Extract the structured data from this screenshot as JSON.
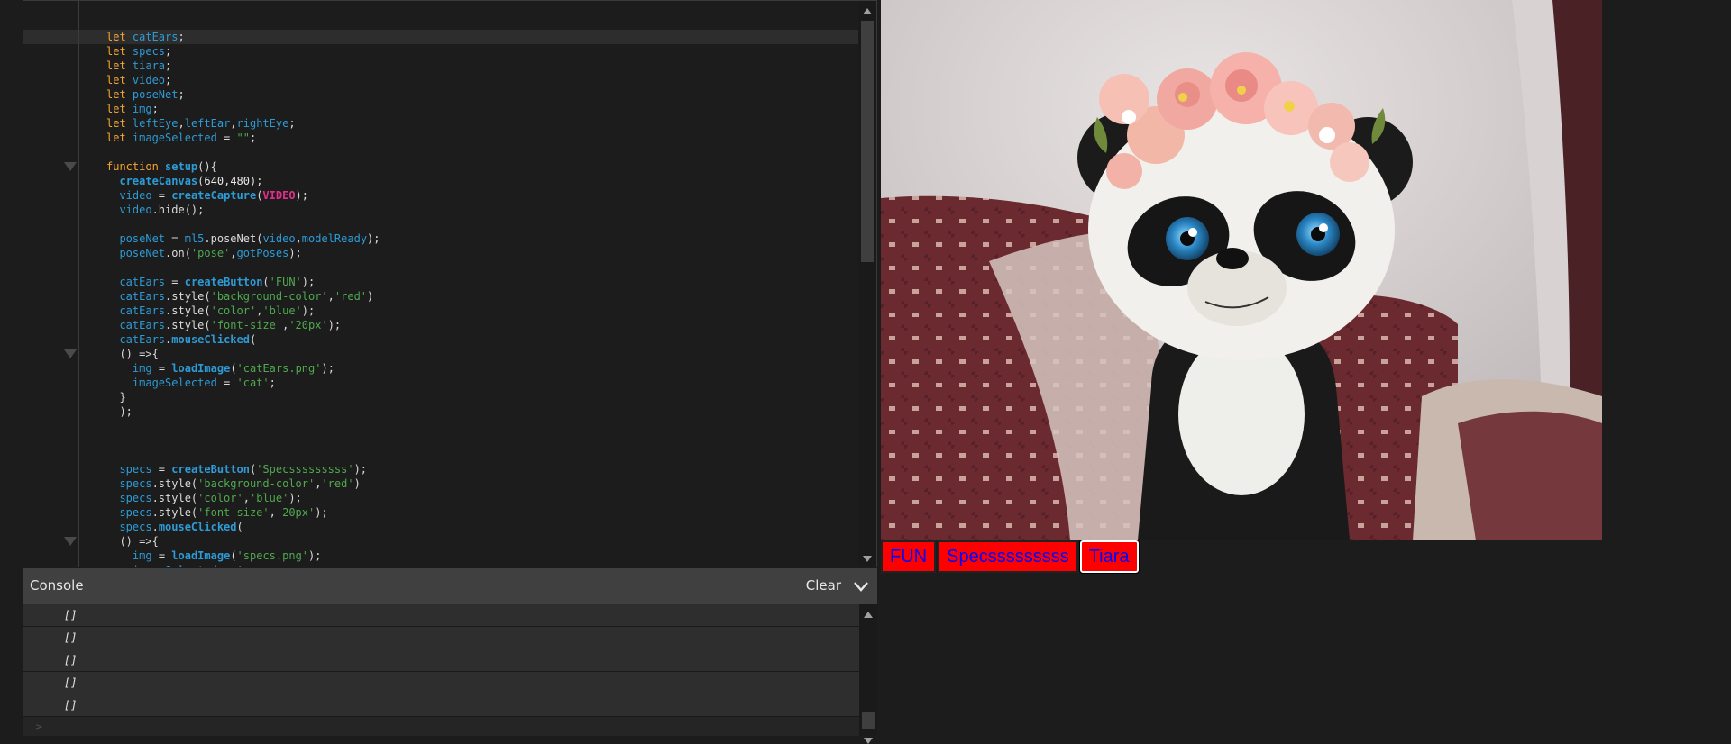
{
  "editor": {
    "lines": [
      {
        "active": true,
        "fold": false,
        "tokens": [
          [
            "kw",
            "let "
          ],
          [
            "var",
            "catEars"
          ],
          [
            "",
            "; "
          ]
        ]
      },
      {
        "fold": false,
        "tokens": [
          [
            "kw",
            "let "
          ],
          [
            "var",
            "specs"
          ],
          [
            "",
            ";"
          ]
        ]
      },
      {
        "fold": false,
        "tokens": [
          [
            "kw",
            "let "
          ],
          [
            "var",
            "tiara"
          ],
          [
            "",
            ";"
          ]
        ]
      },
      {
        "fold": false,
        "tokens": [
          [
            "kw",
            "let "
          ],
          [
            "var",
            "video"
          ],
          [
            "",
            ";"
          ]
        ]
      },
      {
        "fold": false,
        "tokens": [
          [
            "kw",
            "let "
          ],
          [
            "var",
            "poseNet"
          ],
          [
            "",
            ";"
          ]
        ]
      },
      {
        "fold": false,
        "tokens": [
          [
            "kw",
            "let "
          ],
          [
            "var",
            "img"
          ],
          [
            "",
            ";"
          ]
        ]
      },
      {
        "fold": false,
        "tokens": [
          [
            "kw",
            "let "
          ],
          [
            "var",
            "leftEye"
          ],
          [
            "",
            ","
          ],
          [
            "var",
            "leftEar"
          ],
          [
            "",
            ","
          ],
          [
            "var",
            "rightEye"
          ],
          [
            "",
            ";"
          ]
        ]
      },
      {
        "fold": false,
        "tokens": [
          [
            "kw",
            "let "
          ],
          [
            "var",
            "imageSelected"
          ],
          [
            "",
            " = "
          ],
          [
            "str",
            "\"\""
          ],
          [
            "",
            ";"
          ]
        ]
      },
      {
        "fold": false,
        "tokens": []
      },
      {
        "fold": true,
        "tokens": [
          [
            "kw",
            "function "
          ],
          [
            "call",
            "setup"
          ],
          [
            "",
            "(){"
          ]
        ]
      },
      {
        "fold": false,
        "tokens": [
          [
            "",
            "  "
          ],
          [
            "call",
            "createCanvas"
          ],
          [
            "",
            "("
          ],
          [
            "num",
            "640"
          ],
          [
            "",
            ","
          ],
          [
            "num",
            "480"
          ],
          [
            "",
            ");"
          ]
        ]
      },
      {
        "fold": false,
        "tokens": [
          [
            "",
            "  "
          ],
          [
            "var",
            "video"
          ],
          [
            "",
            " = "
          ],
          [
            "call",
            "createCapture"
          ],
          [
            "",
            "("
          ],
          [
            "const",
            "VIDEO"
          ],
          [
            "",
            ");"
          ]
        ]
      },
      {
        "fold": false,
        "tokens": [
          [
            "",
            "  "
          ],
          [
            "var",
            "video"
          ],
          [
            "",
            ".hide();"
          ]
        ]
      },
      {
        "fold": false,
        "tokens": []
      },
      {
        "fold": false,
        "tokens": [
          [
            "",
            "  "
          ],
          [
            "var",
            "poseNet"
          ],
          [
            "",
            " = "
          ],
          [
            "var",
            "ml5"
          ],
          [
            "",
            ".poseNet("
          ],
          [
            "var",
            "video"
          ],
          [
            "",
            ","
          ],
          [
            "var",
            "modelReady"
          ],
          [
            "",
            ");"
          ]
        ]
      },
      {
        "fold": false,
        "tokens": [
          [
            "",
            "  "
          ],
          [
            "var",
            "poseNet"
          ],
          [
            "",
            ".on("
          ],
          [
            "str",
            "'pose'"
          ],
          [
            "",
            ","
          ],
          [
            "var",
            "gotPoses"
          ],
          [
            "",
            ");"
          ]
        ]
      },
      {
        "fold": false,
        "tokens": []
      },
      {
        "fold": false,
        "tokens": [
          [
            "",
            "  "
          ],
          [
            "var",
            "catEars"
          ],
          [
            "",
            " = "
          ],
          [
            "call",
            "createButton"
          ],
          [
            "",
            "("
          ],
          [
            "str",
            "'FUN'"
          ],
          [
            "",
            ");"
          ]
        ]
      },
      {
        "fold": false,
        "tokens": [
          [
            "",
            "  "
          ],
          [
            "var",
            "catEars"
          ],
          [
            "",
            ".style("
          ],
          [
            "str",
            "'background-color'"
          ],
          [
            "",
            ","
          ],
          [
            "str",
            "'red'"
          ],
          [
            "",
            ")"
          ]
        ]
      },
      {
        "fold": false,
        "tokens": [
          [
            "",
            "  "
          ],
          [
            "var",
            "catEars"
          ],
          [
            "",
            ".style("
          ],
          [
            "str",
            "'color'"
          ],
          [
            "",
            ","
          ],
          [
            "str",
            "'blue'"
          ],
          [
            "",
            ");"
          ]
        ]
      },
      {
        "fold": false,
        "tokens": [
          [
            "",
            "  "
          ],
          [
            "var",
            "catEars"
          ],
          [
            "",
            ".style("
          ],
          [
            "str",
            "'font-size'"
          ],
          [
            "",
            ","
          ],
          [
            "str",
            "'20px'"
          ],
          [
            "",
            ");"
          ]
        ]
      },
      {
        "fold": false,
        "tokens": [
          [
            "",
            "  "
          ],
          [
            "var",
            "catEars"
          ],
          [
            "",
            "."
          ],
          [
            "call",
            "mouseClicked"
          ],
          [
            "",
            "("
          ]
        ]
      },
      {
        "fold": true,
        "tokens": [
          [
            "",
            "  () =>{"
          ]
        ]
      },
      {
        "fold": false,
        "tokens": [
          [
            "",
            "    "
          ],
          [
            "var",
            "img"
          ],
          [
            "",
            " = "
          ],
          [
            "call",
            "loadImage"
          ],
          [
            "",
            "("
          ],
          [
            "str",
            "'catEars.png'"
          ],
          [
            "",
            ");"
          ]
        ]
      },
      {
        "fold": false,
        "tokens": [
          [
            "",
            "    "
          ],
          [
            "var",
            "imageSelected"
          ],
          [
            "",
            " = "
          ],
          [
            "str",
            "'cat'"
          ],
          [
            "",
            ";"
          ]
        ]
      },
      {
        "fold": false,
        "tokens": [
          [
            "",
            "  }"
          ]
        ]
      },
      {
        "fold": false,
        "tokens": [
          [
            "",
            "  );"
          ]
        ]
      },
      {
        "fold": false,
        "tokens": []
      },
      {
        "fold": false,
        "tokens": []
      },
      {
        "fold": false,
        "tokens": []
      },
      {
        "fold": false,
        "tokens": [
          [
            "",
            "  "
          ],
          [
            "var",
            "specs"
          ],
          [
            "",
            " = "
          ],
          [
            "call",
            "createButton"
          ],
          [
            "",
            "("
          ],
          [
            "str",
            "'Specsssssssss'"
          ],
          [
            "",
            ");"
          ]
        ]
      },
      {
        "fold": false,
        "tokens": [
          [
            "",
            "  "
          ],
          [
            "var",
            "specs"
          ],
          [
            "",
            ".style("
          ],
          [
            "str",
            "'background-color'"
          ],
          [
            "",
            ","
          ],
          [
            "str",
            "'red'"
          ],
          [
            "",
            ")"
          ]
        ]
      },
      {
        "fold": false,
        "tokens": [
          [
            "",
            "  "
          ],
          [
            "var",
            "specs"
          ],
          [
            "",
            ".style("
          ],
          [
            "str",
            "'color'"
          ],
          [
            "",
            ","
          ],
          [
            "str",
            "'blue'"
          ],
          [
            "",
            ");"
          ]
        ]
      },
      {
        "fold": false,
        "tokens": [
          [
            "",
            "  "
          ],
          [
            "var",
            "specs"
          ],
          [
            "",
            ".style("
          ],
          [
            "str",
            "'font-size'"
          ],
          [
            "",
            ","
          ],
          [
            "str",
            "'20px'"
          ],
          [
            "",
            ");"
          ]
        ]
      },
      {
        "fold": false,
        "tokens": [
          [
            "",
            "  "
          ],
          [
            "var",
            "specs"
          ],
          [
            "",
            "."
          ],
          [
            "call",
            "mouseClicked"
          ],
          [
            "",
            "("
          ]
        ]
      },
      {
        "fold": true,
        "tokens": [
          [
            "",
            "  () =>{"
          ]
        ]
      },
      {
        "fold": false,
        "tokens": [
          [
            "",
            "    "
          ],
          [
            "var",
            "img"
          ],
          [
            "",
            " = "
          ],
          [
            "call",
            "loadImage"
          ],
          [
            "",
            "("
          ],
          [
            "str",
            "'specs.png'"
          ],
          [
            "",
            ");"
          ]
        ]
      },
      {
        "fold": false,
        "tokens": [
          [
            "",
            "    "
          ],
          [
            "var",
            "imageSelected"
          ],
          [
            "",
            " = "
          ],
          [
            "str",
            "'specs'"
          ],
          [
            "",
            ";"
          ]
        ]
      }
    ]
  },
  "console": {
    "title": "Console",
    "clear_label": "Clear",
    "rows": [
      "[]",
      "[]",
      "[]",
      "[]",
      "[]"
    ],
    "prompt": ">"
  },
  "preview": {
    "buttons": [
      {
        "label": "FUN",
        "focused": false
      },
      {
        "label": "Specsssssssss",
        "focused": false
      },
      {
        "label": "Tiara",
        "focused": true
      }
    ],
    "colors": {
      "button_bg": "#ff0000",
      "button_text": "#0000ff"
    }
  }
}
